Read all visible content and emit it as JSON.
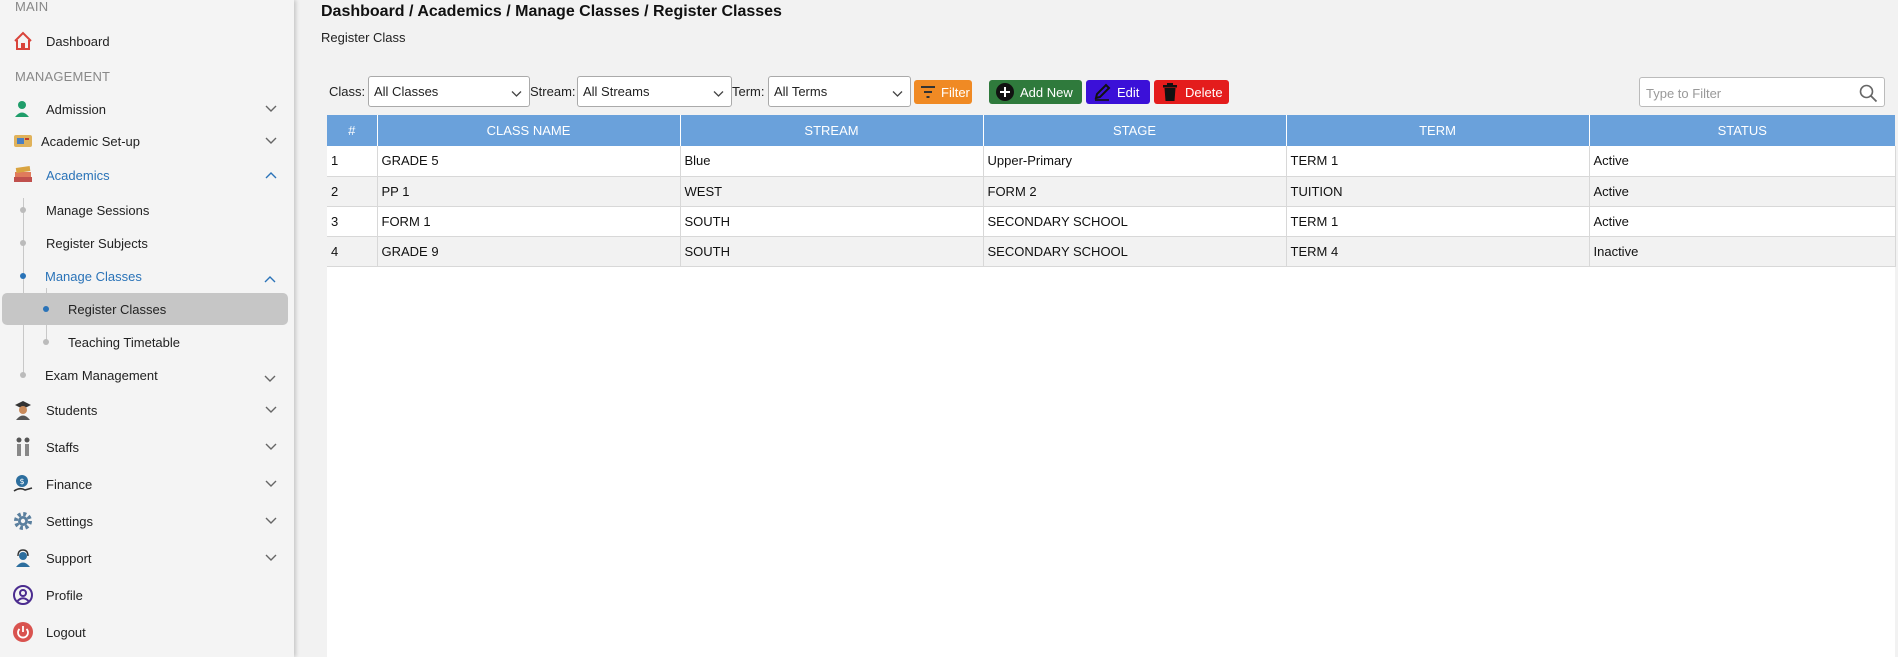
{
  "sidebar": {
    "main_title": "MAIN",
    "management_title": "MANAGEMENT",
    "items": {
      "dashboard": "Dashboard",
      "admission": "Admission",
      "academic_setup": "Academic Set-up",
      "academics": "Academics",
      "manage_sessions": "Manage Sessions",
      "register_subjects": "Register Subjects",
      "manage_classes": "Manage Classes",
      "register_classes": "Register Classes",
      "teaching_timetable": "Teaching Timetable",
      "exam_management": "Exam Management",
      "students": "Students",
      "staffs": "Staffs",
      "finance": "Finance",
      "settings": "Settings",
      "support": "Support",
      "profile": "Profile",
      "logout": "Logout"
    }
  },
  "header": {
    "breadcrumb": "Dashboard / Academics / Manage Classes / Register Classes",
    "subtitle": "Register Class"
  },
  "toolbar": {
    "class_label": "Class:",
    "class_value": "All Classes",
    "stream_label": "Stream:",
    "stream_value": "All Streams",
    "term_label": "Term:",
    "term_value": "All Terms",
    "filter_label": "Filter",
    "add_label": "Add New",
    "edit_label": "Edit",
    "delete_label": "Delete",
    "search_placeholder": "Type to Filter"
  },
  "table": {
    "headers": [
      "#",
      "CLASS NAME",
      "STREAM",
      "STAGE",
      "TERM",
      "STATUS"
    ],
    "rows": [
      [
        "1",
        "GRADE 5",
        "Blue",
        "Upper-Primary",
        "TERM 1",
        "Active"
      ],
      [
        "2",
        "PP 1",
        "WEST",
        "FORM 2",
        "TUITION",
        "Active"
      ],
      [
        "3",
        "FORM 1",
        "SOUTH",
        "SECONDARY SCHOOL",
        "TERM 1",
        "Active"
      ],
      [
        "4",
        "GRADE 9",
        "SOUTH",
        "SECONDARY SCHOOL",
        "TERM 4",
        "Inactive"
      ]
    ]
  },
  "colors": {
    "accent": "#2a73b8",
    "header_bg": "#6aa1db",
    "filter_btn": "#f08a24",
    "add_btn": "#2f7a3c",
    "edit_btn": "#3b10d8",
    "delete_btn": "#e41c1c"
  }
}
